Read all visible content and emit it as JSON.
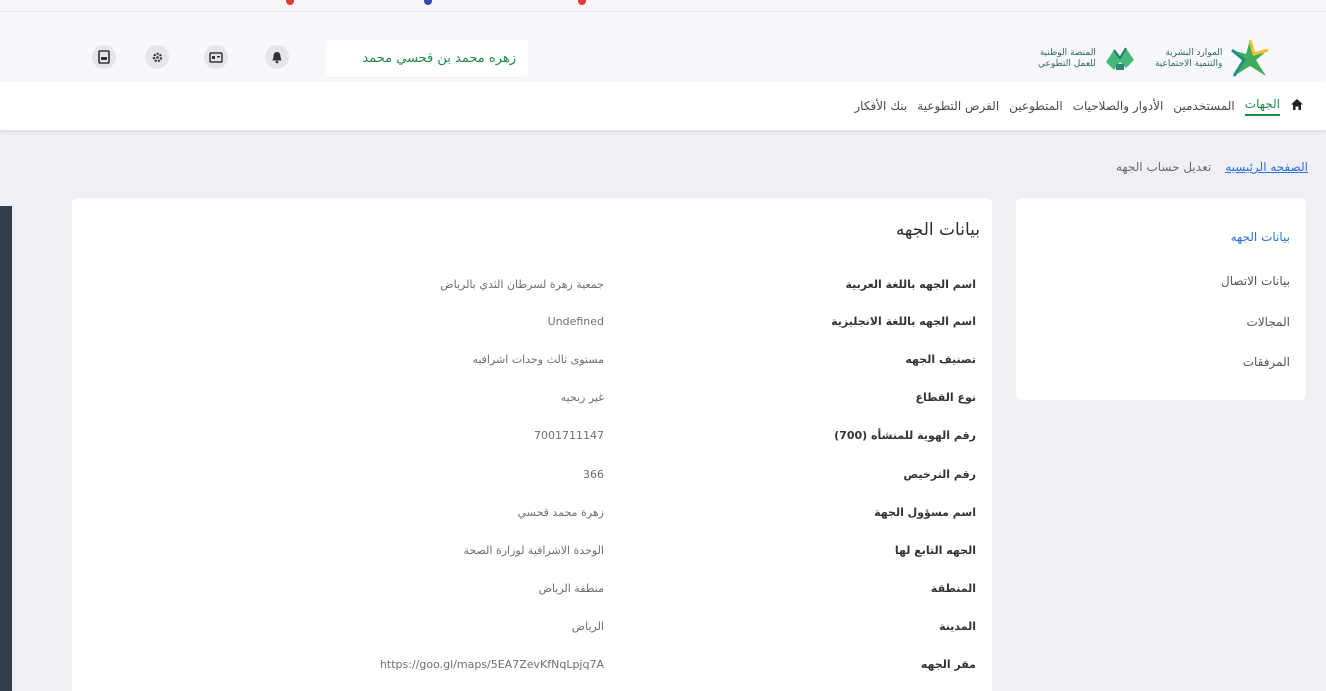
{
  "header": {
    "user_name": "زهره محمد بن قحسي محمد",
    "logo_left_text": "المنصة الوطنية\nللعمل التطوعي",
    "logo_right_text": "الموارد البشرية\nوالتنمية الاجتماعية",
    "icons": [
      "document-icon",
      "gear-icon",
      "id-card-icon",
      "bell-icon"
    ]
  },
  "nav": {
    "items": [
      {
        "label": "الجهات",
        "active": true
      },
      {
        "label": "المستخدمين"
      },
      {
        "label": "الأدوار والصلاحيات"
      },
      {
        "label": "المتطوعين"
      },
      {
        "label": "الفرص التطوعية"
      },
      {
        "label": "بنك الأفكار"
      }
    ]
  },
  "breadcrumb": {
    "home": "الصفحه الرئيسيه",
    "current": "تعديل حساب الجهه"
  },
  "sidebar": {
    "items": [
      {
        "label": "بيانات الجهه",
        "active": true
      },
      {
        "label": "بيانات الاتصال"
      },
      {
        "label": "المجالات"
      },
      {
        "label": "المرفقات"
      }
    ]
  },
  "details": {
    "title": "بيانات الجهه",
    "rows": [
      {
        "label": "اسم الجهه باللغة العربية",
        "value": "جمعية زهرة لسرطان الثدي بالرياض"
      },
      {
        "label": "اسم الجهه باللغة الانجليزية",
        "value": "Undefined"
      },
      {
        "label": "تصنيف الجهه",
        "value": "مستوى ثالث وحدات اشرافيه"
      },
      {
        "label": "نوع القطاع",
        "value": "غير ربحيه"
      },
      {
        "label": "رقم الهوية للمنشأه (700)",
        "value": "7001711147"
      },
      {
        "label": "رقم الترخيص",
        "value": "366"
      },
      {
        "label": "اسم مسؤول الجهة",
        "value": "زهرة محمد قحسي"
      },
      {
        "label": "الجهه التابع لها",
        "value": "الوحدة الاشرافية لوزارة الصحة"
      },
      {
        "label": "المنطقة",
        "value": "منطقة الرياض"
      },
      {
        "label": "المدينة",
        "value": "الرياض"
      },
      {
        "label": "مقر الجهه",
        "value": "https://goo.gl/maps/5EA7ZevKfNqLpjq7A"
      }
    ]
  }
}
